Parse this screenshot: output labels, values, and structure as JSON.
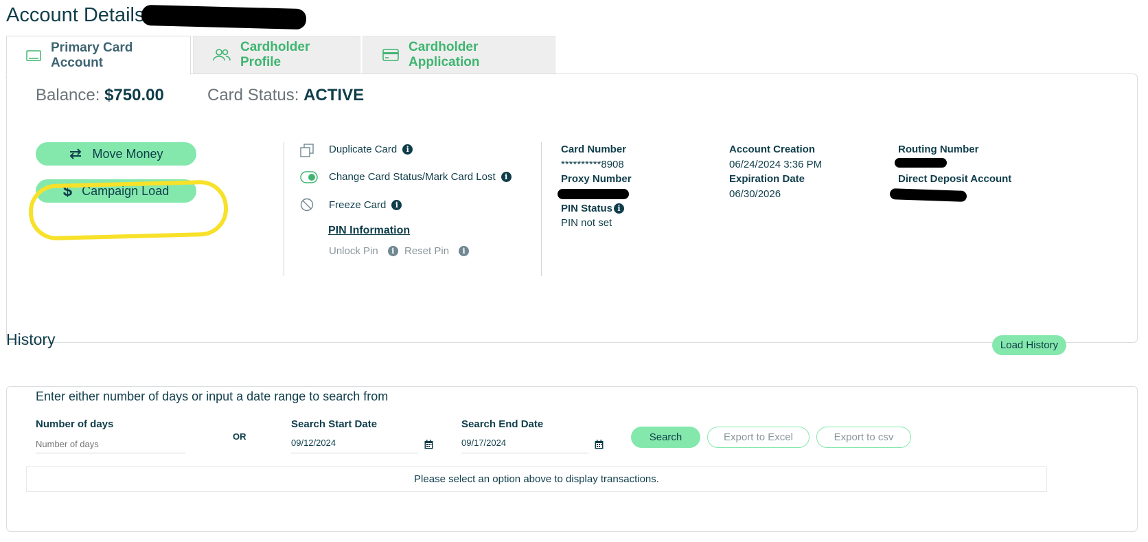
{
  "header": {
    "title": "Account Details:"
  },
  "tabs": [
    {
      "label": "Primary Card Account",
      "icon": "card-outline-icon",
      "active": true
    },
    {
      "label": "Cardholder Profile",
      "icon": "users-icon",
      "active": false
    },
    {
      "label": "Cardholder Application",
      "icon": "credit-card-icon",
      "active": false
    }
  ],
  "summary": {
    "balance_label": "Balance:",
    "balance_value": "$750.00",
    "status_label": "Card Status:",
    "status_value": "ACTIVE"
  },
  "buttons": {
    "move_money": "Move Money",
    "campaign_load": "Campaign Load"
  },
  "actions": {
    "duplicate_card": "Duplicate Card",
    "change_status": "Change Card Status/Mark Card Lost",
    "freeze_card": "Freeze Card",
    "pin_heading": "PIN Information",
    "unlock_pin": "Unlock Pin",
    "reset_pin": "Reset Pin"
  },
  "details": {
    "card_number_label": "Card Number",
    "card_number_value": "**********8908",
    "proxy_number_label": "Proxy Number",
    "pin_status_label": "PIN Status",
    "pin_status_value": "PIN not set",
    "account_creation_label": "Account Creation",
    "account_creation_value": "06/24/2024 3:36 PM",
    "expiration_label": "Expiration Date",
    "expiration_value": "06/30/2026",
    "routing_label": "Routing Number",
    "direct_deposit_label": "Direct Deposit Account"
  },
  "history": {
    "title": "History",
    "load_button": "Load History",
    "instruction": "Enter either number of days or input a date range to search from",
    "days_label": "Number of days",
    "days_placeholder": "Number of days",
    "or_text": "OR",
    "start_label": "Search Start Date",
    "start_value": "09/12/2024",
    "end_label": "Search End Date",
    "end_value": "09/17/2024",
    "search_button": "Search",
    "export_excel": "Export to Excel",
    "export_csv": "Export to csv",
    "notice": "Please select an option above to display transactions."
  },
  "colors": {
    "accent_green": "#84e8ad",
    "tab_green": "#3fb570",
    "text_dark": "#0f3d4a",
    "highlight": "#f7e12a"
  }
}
